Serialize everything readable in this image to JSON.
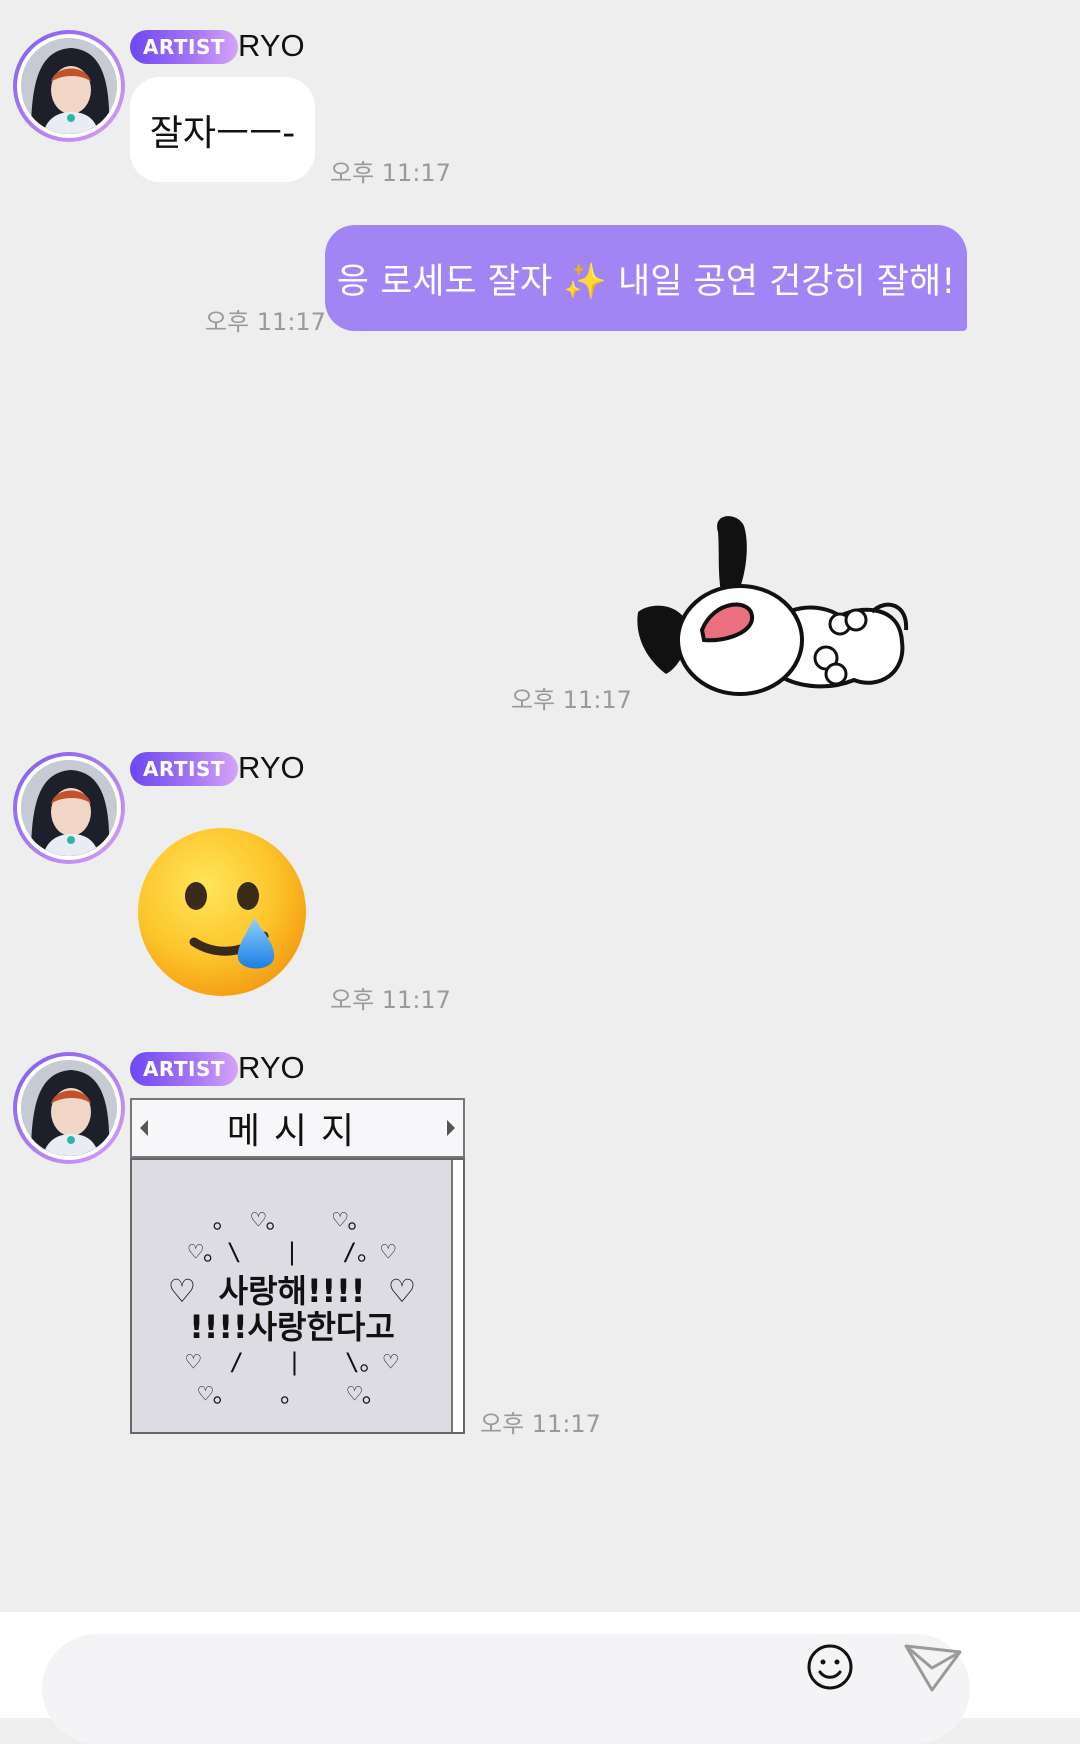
{
  "messages": [
    {
      "sender": {
        "badge": "ARTIST",
        "name": "RYO"
      },
      "text": "잘자ㅡㅡ-",
      "time": "오후 11:17"
    },
    {
      "outgoing": true,
      "text": "응 로세도 잘자 ✨ 내일 공연 건강히 잘해!",
      "time": "오후 11:17"
    },
    {
      "outgoing": true,
      "sticker": "sleeping-dog-sticker",
      "time": "오후 11:17"
    },
    {
      "sender": {
        "badge": "ARTIST",
        "name": "RYO"
      },
      "emoji": "😢",
      "time": "오후 11:17"
    },
    {
      "sender": {
        "badge": "ARTIST",
        "name": "RYO"
      },
      "card": {
        "title": "메시지",
        "lines": [
          "。 ♡。   ♡。",
          "♡。\\   |   /。♡",
          "♡  사랑해!!!!  ♡",
          "!!!!사랑한다고",
          "♡  /   |   \\。♡",
          "♡。   。   ♡。"
        ]
      },
      "time": "오후 11:17"
    }
  ],
  "input": {
    "placeholder": ""
  },
  "icons": {
    "emoji": "smiley-icon",
    "send": "paper-plane-icon"
  },
  "colors": {
    "outgoing_bubble": "#a384f4",
    "badge_start": "#6e47f2",
    "badge_end": "#d6a4f7",
    "background": "#eeeeef"
  }
}
